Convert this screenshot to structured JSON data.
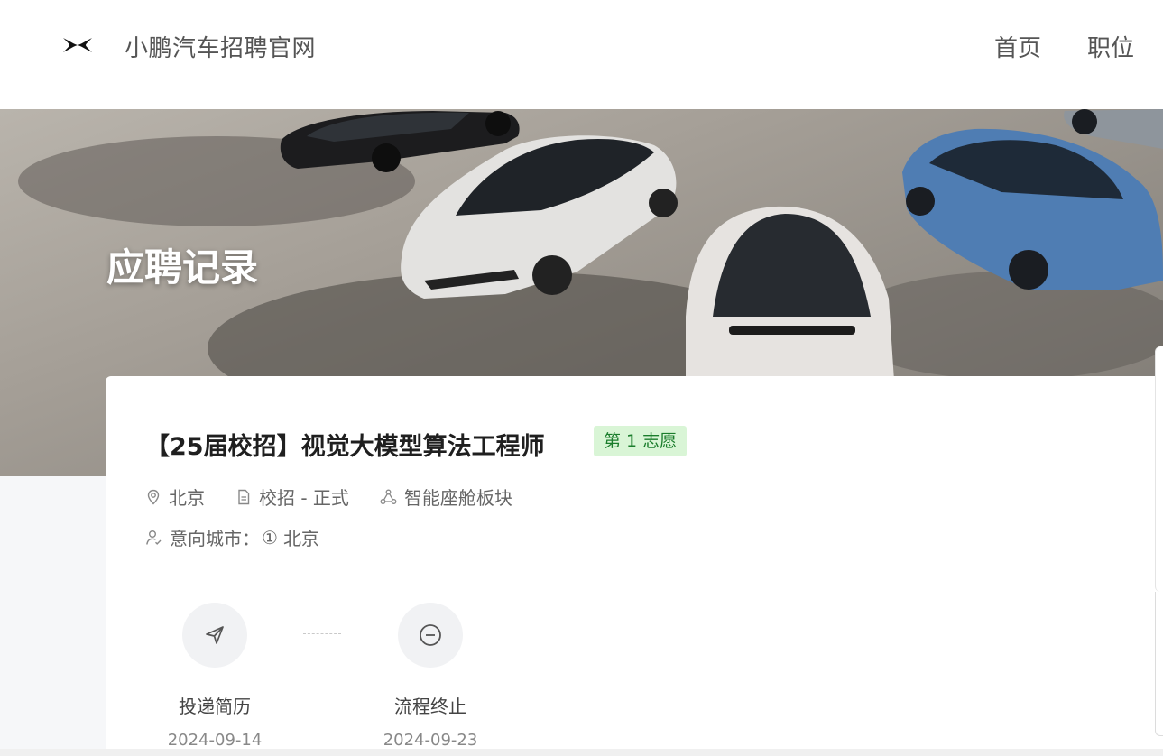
{
  "header": {
    "site_title": "小鹏汽车招聘官网",
    "nav": {
      "home": "首页",
      "jobs": "职位"
    },
    "logo_icon": "xpeng-logo-icon"
  },
  "banner": {
    "title": "应聘记录"
  },
  "application": {
    "job_title": "【25届校招】视觉大模型算法工程师",
    "choice_badge": "第 1 志愿",
    "location": "北京",
    "type": "校招 - 正式",
    "department": "智能座舱板块",
    "intended_city_label": "意向城市：",
    "intended_city_index": "①",
    "intended_city": "北京",
    "steps": [
      {
        "label": "投递简历",
        "date": "2024-09-14",
        "icon": "send-icon"
      },
      {
        "label": "流程终止",
        "date": "2024-09-23",
        "icon": "minus-circle-icon"
      }
    ]
  },
  "colors": {
    "badge_bg": "#d9f5d6",
    "badge_text": "#1b7d2c",
    "page_bg": "#f6f7f9"
  }
}
